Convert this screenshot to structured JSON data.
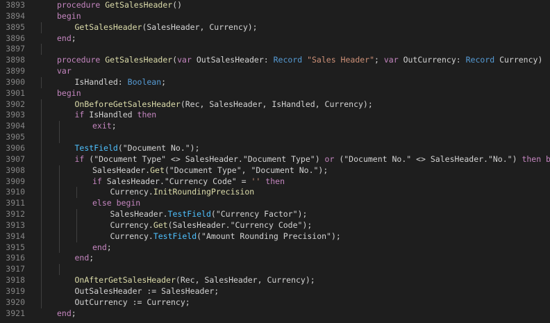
{
  "theme": {
    "background": "#1e1e1e",
    "line_number": "#858585",
    "default_text": "#d4d4d4",
    "keyword": "#c586c0",
    "type": "#569cd6",
    "function": "#dcdcaa",
    "string": "#ce9178",
    "member": "#4fc1ff"
  },
  "lines": [
    {
      "n": "3893",
      "indent": 1,
      "tokens": [
        [
          "kw",
          "procedure "
        ],
        [
          "fn",
          "GetSalesHeader"
        ],
        [
          "tx",
          "()"
        ]
      ]
    },
    {
      "n": "3894",
      "indent": 1,
      "tokens": [
        [
          "kw",
          "begin"
        ]
      ]
    },
    {
      "n": "3895",
      "indent": 2,
      "tokens": [
        [
          "fn",
          "GetSalesHeader"
        ],
        [
          "tx",
          "(SalesHeader, Currency);"
        ]
      ]
    },
    {
      "n": "3896",
      "indent": 1,
      "tokens": [
        [
          "kw",
          "end"
        ],
        [
          "tx",
          ";"
        ]
      ]
    },
    {
      "n": "3897",
      "indent": 0,
      "tokens": []
    },
    {
      "n": "3898",
      "indent": 1,
      "tokens": [
        [
          "kw",
          "procedure "
        ],
        [
          "fn",
          "GetSalesHeader"
        ],
        [
          "tx",
          "("
        ],
        [
          "kw",
          "var"
        ],
        [
          "tx",
          " OutSalesHeader: "
        ],
        [
          "ty",
          "Record"
        ],
        [
          "st",
          " \"Sales Header\""
        ],
        [
          "tx",
          "; "
        ],
        [
          "kw",
          "var"
        ],
        [
          "tx",
          " OutCurrency: "
        ],
        [
          "ty",
          "Record"
        ],
        [
          "tx",
          " Currency)"
        ]
      ]
    },
    {
      "n": "3899",
      "indent": 1,
      "tokens": [
        [
          "kw",
          "var"
        ]
      ]
    },
    {
      "n": "3900",
      "indent": 2,
      "tokens": [
        [
          "tx",
          "IsHandled: "
        ],
        [
          "ty",
          "Boolean"
        ],
        [
          "tx",
          ";"
        ]
      ]
    },
    {
      "n": "3901",
      "indent": 1,
      "tokens": [
        [
          "kw",
          "begin"
        ]
      ]
    },
    {
      "n": "3902",
      "indent": 2,
      "tokens": [
        [
          "fn",
          "OnBeforeGetSalesHeader"
        ],
        [
          "tx",
          "(Rec, SalesHeader, IsHandled, Currency);"
        ]
      ]
    },
    {
      "n": "3903",
      "indent": 2,
      "tokens": [
        [
          "kw",
          "if"
        ],
        [
          "tx",
          " IsHandled "
        ],
        [
          "kw",
          "then"
        ]
      ]
    },
    {
      "n": "3904",
      "indent": 3,
      "tokens": [
        [
          "kw",
          "exit"
        ],
        [
          "tx",
          ";"
        ]
      ]
    },
    {
      "n": "3905",
      "indent": 0,
      "tokens": []
    },
    {
      "n": "3906",
      "indent": 2,
      "tokens": [
        [
          "mb",
          "TestField"
        ],
        [
          "tx",
          "(\"Document No.\");"
        ]
      ]
    },
    {
      "n": "3907",
      "indent": 2,
      "tokens": [
        [
          "kw",
          "if"
        ],
        [
          "tx",
          " (\"Document Type\" <> SalesHeader.\"Document Type\") "
        ],
        [
          "kw",
          "or"
        ],
        [
          "tx",
          " (\"Document No.\" <> SalesHeader.\"No.\") "
        ],
        [
          "kw",
          "then begin"
        ]
      ]
    },
    {
      "n": "3908",
      "indent": 3,
      "tokens": [
        [
          "tx",
          "SalesHeader."
        ],
        [
          "fn",
          "Get"
        ],
        [
          "tx",
          "(\"Document Type\", \"Document No.\");"
        ]
      ]
    },
    {
      "n": "3909",
      "indent": 3,
      "tokens": [
        [
          "kw",
          "if"
        ],
        [
          "tx",
          " SalesHeader.\"Currency Code\" = "
        ],
        [
          "st",
          "''"
        ],
        [
          "tx",
          " "
        ],
        [
          "kw",
          "then"
        ]
      ]
    },
    {
      "n": "3910",
      "indent": 4,
      "tokens": [
        [
          "tx",
          "Currency."
        ],
        [
          "fn",
          "InitRoundingPrecision"
        ]
      ]
    },
    {
      "n": "3911",
      "indent": 3,
      "tokens": [
        [
          "kw",
          "else begin"
        ]
      ]
    },
    {
      "n": "3912",
      "indent": 4,
      "tokens": [
        [
          "tx",
          "SalesHeader."
        ],
        [
          "mb",
          "TestField"
        ],
        [
          "tx",
          "(\"Currency Factor\");"
        ]
      ]
    },
    {
      "n": "3913",
      "indent": 4,
      "tokens": [
        [
          "tx",
          "Currency."
        ],
        [
          "fn",
          "Get"
        ],
        [
          "tx",
          "(SalesHeader.\"Currency Code\");"
        ]
      ]
    },
    {
      "n": "3914",
      "indent": 4,
      "tokens": [
        [
          "tx",
          "Currency."
        ],
        [
          "mb",
          "TestField"
        ],
        [
          "tx",
          "(\"Amount Rounding Precision\");"
        ]
      ]
    },
    {
      "n": "3915",
      "indent": 3,
      "tokens": [
        [
          "kw",
          "end"
        ],
        [
          "tx",
          ";"
        ]
      ]
    },
    {
      "n": "3916",
      "indent": 2,
      "tokens": [
        [
          "kw",
          "end"
        ],
        [
          "tx",
          ";"
        ]
      ]
    },
    {
      "n": "3917",
      "indent": 0,
      "tokens": []
    },
    {
      "n": "3918",
      "indent": 2,
      "tokens": [
        [
          "fn",
          "OnAfterGetSalesHeader"
        ],
        [
          "tx",
          "(Rec, SalesHeader, Currency);"
        ]
      ]
    },
    {
      "n": "3919",
      "indent": 2,
      "tokens": [
        [
          "tx",
          "OutSalesHeader "
        ],
        [
          "op",
          ":="
        ],
        [
          "tx",
          " SalesHeader;"
        ]
      ]
    },
    {
      "n": "3920",
      "indent": 2,
      "tokens": [
        [
          "tx",
          "OutCurrency "
        ],
        [
          "op",
          ":="
        ],
        [
          "tx",
          " Currency;"
        ]
      ]
    },
    {
      "n": "3921",
      "indent": 1,
      "tokens": [
        [
          "kw",
          "end"
        ],
        [
          "tx",
          ";"
        ]
      ]
    }
  ]
}
